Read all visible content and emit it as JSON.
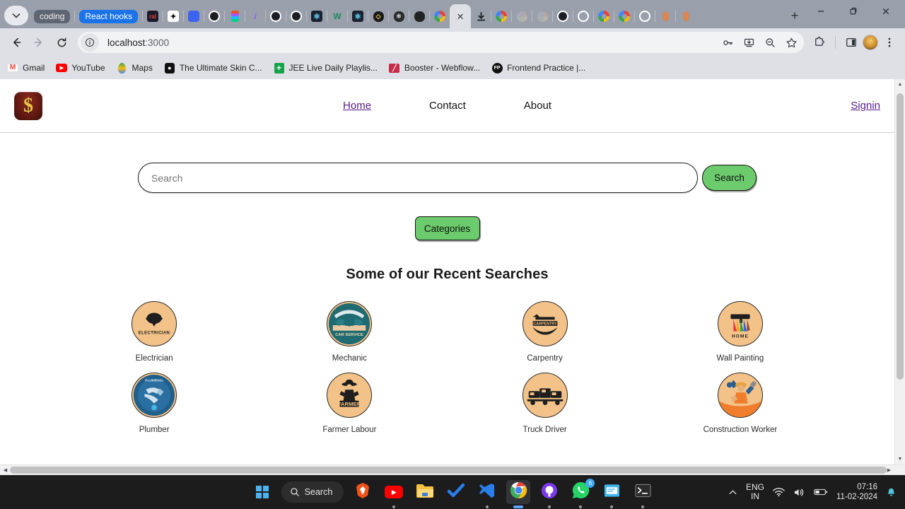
{
  "browser": {
    "tab_search_icon": "chevron-down-icon",
    "tabs": [
      {
        "type": "chip",
        "label": "coding",
        "style": "grey"
      },
      {
        "type": "chip",
        "label": "React hooks",
        "style": "blue"
      },
      {
        "type": "favicon",
        "icon": "reddit-icon"
      },
      {
        "type": "favicon",
        "icon": "sparkle-icon"
      },
      {
        "type": "favicon",
        "icon": "blue-square-icon"
      },
      {
        "type": "favicon",
        "icon": "github-icon"
      },
      {
        "type": "favicon",
        "icon": "figma-icon"
      },
      {
        "type": "favicon",
        "icon": "letter-i-icon"
      },
      {
        "type": "favicon",
        "icon": "github-icon"
      },
      {
        "type": "favicon",
        "icon": "github-icon"
      },
      {
        "type": "favicon",
        "icon": "react-icon"
      },
      {
        "type": "favicon",
        "icon": "webflow-icon"
      },
      {
        "type": "favicon",
        "icon": "react-icon"
      },
      {
        "type": "favicon",
        "icon": "css-icon"
      },
      {
        "type": "favicon",
        "icon": "dark-globe-icon"
      },
      {
        "type": "favicon",
        "icon": "dark-circle-icon"
      },
      {
        "type": "favicon",
        "icon": "google-icon"
      },
      {
        "type": "active",
        "icon": "close-icon"
      },
      {
        "type": "favicon",
        "icon": "download-icon"
      },
      {
        "type": "favicon",
        "icon": "google-icon"
      },
      {
        "type": "favicon",
        "icon": "faded-icon"
      },
      {
        "type": "favicon",
        "icon": "faded-icon"
      },
      {
        "type": "favicon",
        "icon": "github-icon"
      },
      {
        "type": "favicon",
        "icon": "github-outline-icon"
      },
      {
        "type": "favicon",
        "icon": "google-icon"
      },
      {
        "type": "favicon",
        "icon": "google-icon"
      },
      {
        "type": "favicon",
        "icon": "github-outline-icon"
      },
      {
        "type": "favicon",
        "icon": "orange-flame-icon"
      },
      {
        "type": "favicon",
        "icon": "orange-flame-icon"
      }
    ],
    "new_tab_label": "+",
    "window_minimize": "minimize-icon",
    "window_restore": "restore-icon",
    "window_close": "close-icon",
    "toolbar": {
      "back_icon": "back-arrow-icon",
      "forward_icon": "forward-arrow-icon",
      "reload_icon": "reload-icon",
      "site_info_icon": "info-circle-icon",
      "url_host": "localhost",
      "url_port": ":3000",
      "url_full": "localhost:3000",
      "actions": [
        {
          "icon": "password-key-icon"
        },
        {
          "icon": "install-app-icon"
        },
        {
          "icon": "zoom-out-icon"
        },
        {
          "icon": "bookmark-star-icon"
        }
      ],
      "extensions_icon": "extensions-puzzle-icon",
      "sidepanel_icon": "side-panel-icon",
      "profile_icon": "profile-avatar-icon",
      "menu_icon": "three-dot-menu-icon"
    },
    "bookmarks": [
      {
        "label": "Gmail",
        "icon": "gmail-icon"
      },
      {
        "label": "YouTube",
        "icon": "youtube-icon"
      },
      {
        "label": "Maps",
        "icon": "maps-pin-icon"
      },
      {
        "label": "The Ultimate Skin C...",
        "icon": "notion-icon"
      },
      {
        "label": "JEE Live Daily Playlis...",
        "icon": "green-plus-icon"
      },
      {
        "label": "Booster - Webflow...",
        "icon": "booster-icon"
      },
      {
        "label": "Frontend Practice |...",
        "icon": "fp-icon"
      }
    ]
  },
  "site": {
    "logo_symbol": "$",
    "nav": [
      {
        "label": "Home",
        "visited": true
      },
      {
        "label": "Contact",
        "visited": false
      },
      {
        "label": "About",
        "visited": false
      }
    ],
    "signin_label": "Signin",
    "search": {
      "value": "",
      "placeholder": "Search",
      "button_label": "Search"
    },
    "categories_button_label": "Categories",
    "recent_title": "Some of our Recent Searches",
    "recent_items": [
      {
        "label": "Electrician",
        "icon": "electrician-badge-icon"
      },
      {
        "label": "Mechanic",
        "icon": "mechanic-badge-icon"
      },
      {
        "label": "Carpentry",
        "icon": "carpentry-badge-icon"
      },
      {
        "label": "Wall Painting",
        "icon": "wall-painting-badge-icon"
      },
      {
        "label": "Plumber",
        "icon": "plumber-badge-icon"
      },
      {
        "label": "Farmer Labour",
        "icon": "farmer-badge-icon"
      },
      {
        "label": "Truck Driver",
        "icon": "truck-driver-badge-icon"
      },
      {
        "label": "Construction Worker",
        "icon": "construction-worker-badge-icon"
      }
    ]
  },
  "taskbar": {
    "start_icon": "windows-start-icon",
    "search_label": "Search",
    "search_icon": "search-icon",
    "items": [
      {
        "icon": "brave-icon",
        "running": false,
        "active": false
      },
      {
        "icon": "youtube-icon",
        "running": true,
        "active": false
      },
      {
        "icon": "file-explorer-icon",
        "running": false,
        "active": false
      },
      {
        "icon": "todo-check-icon",
        "running": false,
        "active": false
      },
      {
        "icon": "vscode-icon",
        "running": true,
        "active": false
      },
      {
        "icon": "chrome-icon",
        "running": true,
        "active": true
      },
      {
        "icon": "github-desktop-icon",
        "running": true,
        "active": false
      },
      {
        "icon": "whatsapp-icon",
        "running": true,
        "active": false,
        "badge": "6"
      },
      {
        "icon": "sticky-notes-icon",
        "running": true,
        "active": false
      },
      {
        "icon": "terminal-icon",
        "running": true,
        "active": false
      }
    ],
    "tray": {
      "overflow_icon": "chevron-up-icon",
      "language_top": "ENG",
      "language_bottom": "IN",
      "wifi_icon": "wifi-icon",
      "volume_icon": "volume-icon",
      "battery_icon": "battery-icon",
      "time": "07:16",
      "date": "11-02-2024",
      "notification_icon": "bell-icon"
    }
  },
  "colors": {
    "accent_green": "#6ccb6c",
    "badge_peach": "#f3c288",
    "visited_link": "#551a8b",
    "tabstrip": "#9aa0ab",
    "toolbar": "#dee0e6",
    "taskbar": "#1c1c1c"
  }
}
